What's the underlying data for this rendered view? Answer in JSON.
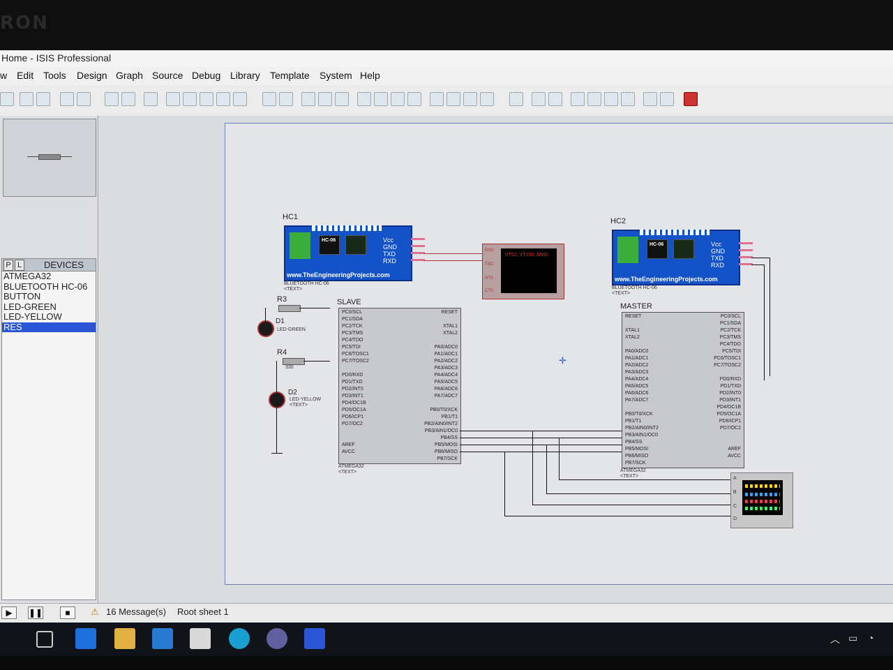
{
  "window": {
    "title": "Home - ISIS Professional"
  },
  "menu": [
    "w",
    "Edit",
    "Tools",
    "Design",
    "Graph",
    "Source",
    "Debug",
    "Library",
    "Template",
    "System",
    "Help"
  ],
  "devices": {
    "tabs": [
      "P",
      "L"
    ],
    "header": "DEVICES",
    "items": [
      "ATMEGA32",
      "BLUETOOTH HC-06",
      "BUTTON",
      "LED-GREEN",
      "LED-YELLOW",
      "RES"
    ],
    "selected_index": 5
  },
  "schematic": {
    "hc1": {
      "ref": "HC1",
      "part": "BLUETOOTH HC-06",
      "text": "<TEXT>",
      "chip": "HC-06",
      "pins": [
        "Vcc",
        "GND",
        "TXD",
        "RXD"
      ],
      "site": "www.TheEngineeringProjects.com"
    },
    "hc2": {
      "ref": "HC2",
      "part": "BLUETOOTH HC-06",
      "text": "<TEXT>",
      "chip": "HC-06",
      "pins": [
        "Vcc",
        "GND",
        "TXD",
        "RXD"
      ],
      "site": "www.TheEngineeringProjects.com"
    },
    "terminal": {
      "screen_text": "VT52, VT100, ANSI",
      "pins": [
        "RXD",
        "TXD",
        "RTS",
        "CTS"
      ]
    },
    "slave": {
      "label": "SLAVE",
      "part": "ATMEGA32",
      "text": "<TEXT>",
      "left_pins": [
        "PC0/SCL",
        "PC1/SDA",
        "PC2/TCK",
        "PC3/TMS",
        "PC4/TDO",
        "PC5/TDI",
        "PC6/TOSC1",
        "PC7/TOSC2",
        "",
        "PD0/RXD",
        "PD1/TXD",
        "PD2/INT0",
        "PD3/INT1",
        "PD4/OC1B",
        "PD5/OC1A",
        "PD6/ICP1",
        "PD7/OC2",
        "",
        "",
        "AREF",
        "AVCC"
      ],
      "right_pins": [
        "RESET",
        "",
        "XTAL1",
        "XTAL2",
        "",
        "PA0/ADC0",
        "PA1/ADC1",
        "PA2/ADC2",
        "PA3/ADC3",
        "PA4/ADC4",
        "PA5/ADC5",
        "PA6/ADC6",
        "PA7/ADC7",
        "",
        "PB0/T0/XCK",
        "PB1/T1",
        "PB2/AIN0/INT2",
        "PB3/AIN1/OC0",
        "PB4/SS",
        "PB5/MOSI",
        "PB6/MISO",
        "PB7/SCK"
      ]
    },
    "master": {
      "label": "MASTER",
      "part": "ATMEGA32",
      "text": "<TEXT>",
      "left_pins": [
        "RESET",
        "",
        "XTAL1",
        "XTAL2",
        "",
        "PA0/ADC0",
        "PA1/ADC1",
        "PA2/ADC2",
        "PA3/ADC3",
        "PA4/ADC4",
        "PA5/ADC5",
        "PA6/ADC6",
        "PA7/ADC7",
        "",
        "PB0/T0/XCK",
        "PB1/T1",
        "PB2/AIN0/INT2",
        "PB3/AIN1/OC0",
        "PB4/SS",
        "PB5/MOSI",
        "PB6/MISO",
        "PB7/SCK"
      ],
      "right_pins": [
        "PC0/SCL",
        "PC1/SDA",
        "PC2/TCK",
        "PC3/TMS",
        "PC4/TDO",
        "PC5/TDI",
        "PC6/TOSC1",
        "PC7/TOSC2",
        "",
        "PD0/RXD",
        "PD1/TXD",
        "PD2/INT0",
        "PD3/INT1",
        "PD4/OC1B",
        "PD5/OC1A",
        "PD6/ICP1",
        "PD7/OC2",
        "",
        "",
        "AREF",
        "AVCC"
      ]
    },
    "r3": {
      "ref": "R3"
    },
    "r4": {
      "ref": "R4",
      "value": "330"
    },
    "d1": {
      "ref": "D1",
      "part": "LED-GREEN"
    },
    "d2": {
      "ref": "D2",
      "part": "LED-YELLOW",
      "text": "<TEXT>"
    },
    "scope_channels": [
      "A",
      "B",
      "C",
      "D"
    ]
  },
  "status": {
    "messages": "16 Message(s)",
    "sheet": "Root sheet 1"
  },
  "taskbar": [
    "search",
    "task-view",
    "edge",
    "file-explorer",
    "store",
    "mail",
    "edge-new",
    "app",
    "isis"
  ]
}
